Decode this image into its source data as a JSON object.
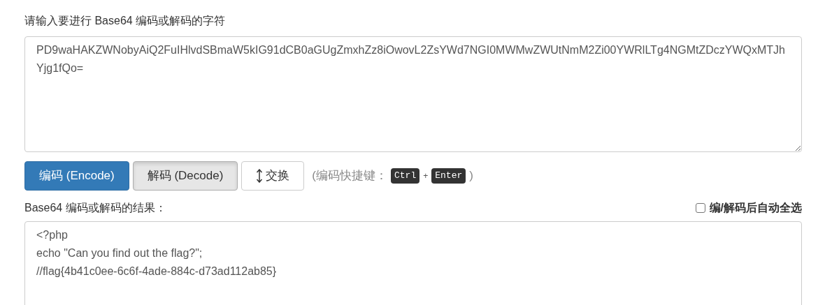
{
  "input": {
    "label": "请输入要进行 Base64 编码或解码的字符",
    "value": "PD9waHAKZWNobyAiQ2FuIHlvdSBmaW5kIG91dCB0aGUgZmxhZz8iOwovL2ZsYWd7NGI0MWMwZWUtNmM2Zi00YWRlLTg4NGMtZDczYWQxMTJhYjg1fQo="
  },
  "buttons": [
    {
      "kind": "primary",
      "label": "编码 (Encode)"
    },
    {
      "kind": "pressed",
      "label": "解码 (Decode)"
    },
    {
      "kind": "swap",
      "label": "交换"
    }
  ],
  "shortcut": {
    "open": "(编码快捷键：",
    "keys": [
      "Ctrl",
      "Enter"
    ],
    "plus": "+",
    "close": ")"
  },
  "result": {
    "label": "Base64 编码或解码的结果：",
    "auto_select": {
      "label": "编/解码后自动全选",
      "checked": false
    },
    "value": "<?php\necho \"Can you find out the flag?\";\n//flag{4b41c0ee-6c6f-4ade-884c-d73ad112ab85}"
  }
}
